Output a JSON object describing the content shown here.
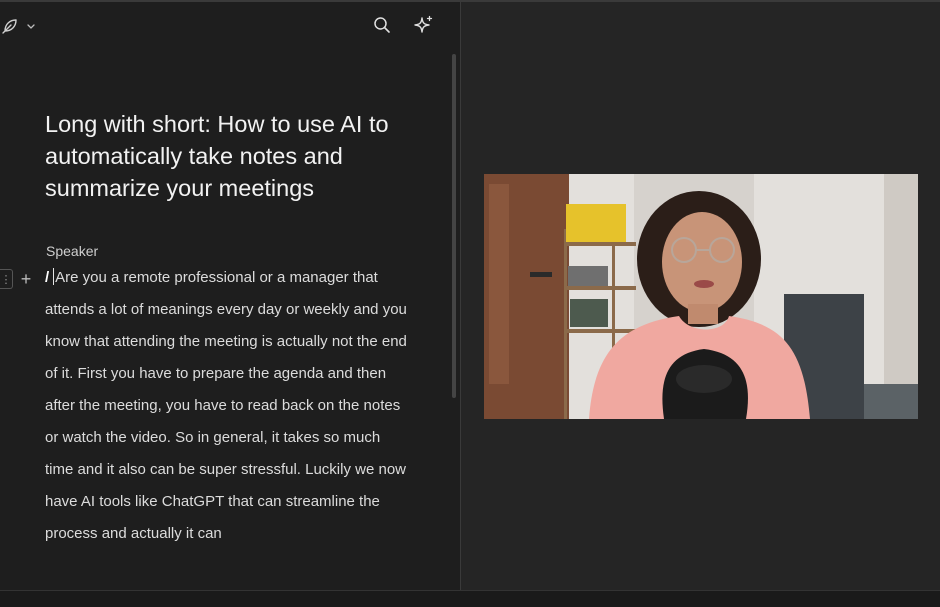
{
  "editor": {
    "title": "Long with short: How to use AI to automatically take notes and summarize your meetings",
    "speaker": "Speaker",
    "slash": "/",
    "body": "Are you a remote professional or a manager that attends a lot of meanings every day or weekly and you know that attending the meeting is actually not the end of it. First you have to prepare the agenda and then after the meeting, you have to read back on the notes or watch the video. So in general, it takes so much time and it also can be super stressful. Luckily we now have AI tools like ChatGPT that can streamline the process and actually it can"
  },
  "icons": {
    "toolbar_left": [
      "feather-icon",
      "chevron-down-icon"
    ],
    "toolbar_right": [
      "search-icon",
      "sparkle-icon"
    ]
  },
  "colors": {
    "background": "#1e1e1e",
    "video_pane": "#252525",
    "shirt": "#f0a8a0"
  }
}
